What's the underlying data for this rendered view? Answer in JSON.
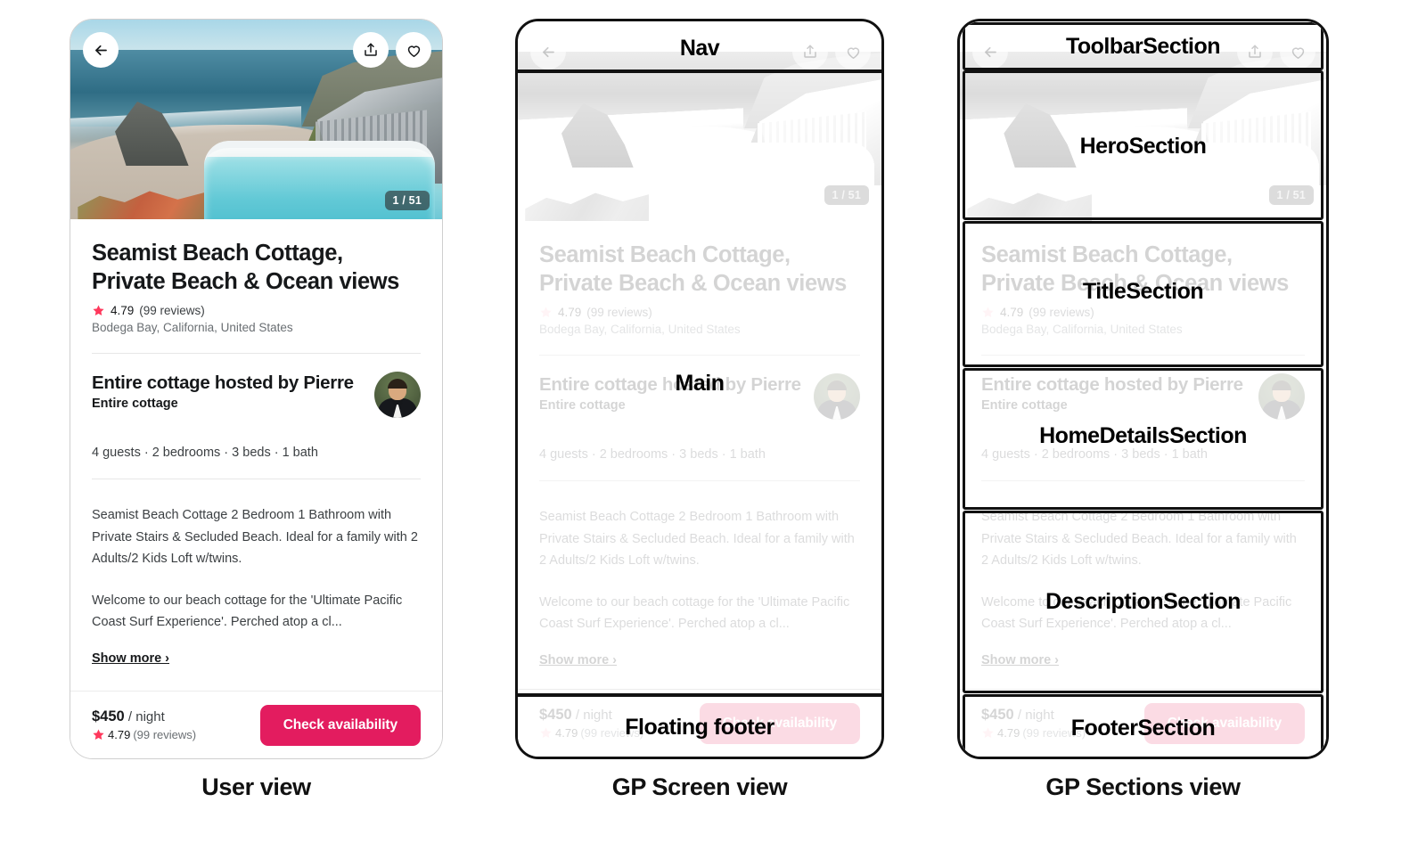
{
  "listing": {
    "title": "Seamist Beach Cottage, Private Beach & Ocean views",
    "rating": "4.79",
    "reviews": "(99 reviews)",
    "location": "Bodega Bay, California, United States",
    "photo_counter": "1 / 51",
    "host_heading": "Entire cottage hosted by Pierre",
    "host_subtitle": "Entire cottage",
    "facts": "4 guests  ·  2 bedrooms  ·  3 beds  ·  1 bath",
    "description_p1": "Seamist Beach Cottage 2 Bedroom 1 Bathroom with Private Stairs & Secluded Beach. Ideal for a family with 2 Adults/2 Kids Loft w/twins.",
    "description_p2": "Welcome to our beach cottage for the 'Ultimate Pacific Coast Surf Experience'. Perched atop a cl...",
    "show_more": "Show more  ›",
    "price_amount": "$450",
    "price_per": " / night",
    "footer_rating": "4.79",
    "footer_reviews": "(99 reviews)",
    "cta_label": "Check availability"
  },
  "icons": {
    "back": "back-arrow-icon",
    "share": "share-icon",
    "heart": "heart-icon",
    "star": "star-icon"
  },
  "annotations": {
    "screen": {
      "nav": "Nav",
      "main": "Main",
      "floating_footer": "Floating footer"
    },
    "sections": {
      "toolbar": "ToolbarSection",
      "hero": "HeroSection",
      "title": "TitleSection",
      "home_details": "HomeDetailsSection",
      "description": "DescriptionSection",
      "footer": "FooterSection"
    }
  },
  "captions": {
    "user": "User view",
    "screen": "GP Screen view",
    "sections": "GP Sections view"
  },
  "colors": {
    "accent": "#E31C5F",
    "accent_faded": "#FBDBE4",
    "text_primary": "#16181A",
    "text_secondary": "#6A6F73",
    "frame_dark": "#111111",
    "frame_light": "#CFCFCF"
  }
}
